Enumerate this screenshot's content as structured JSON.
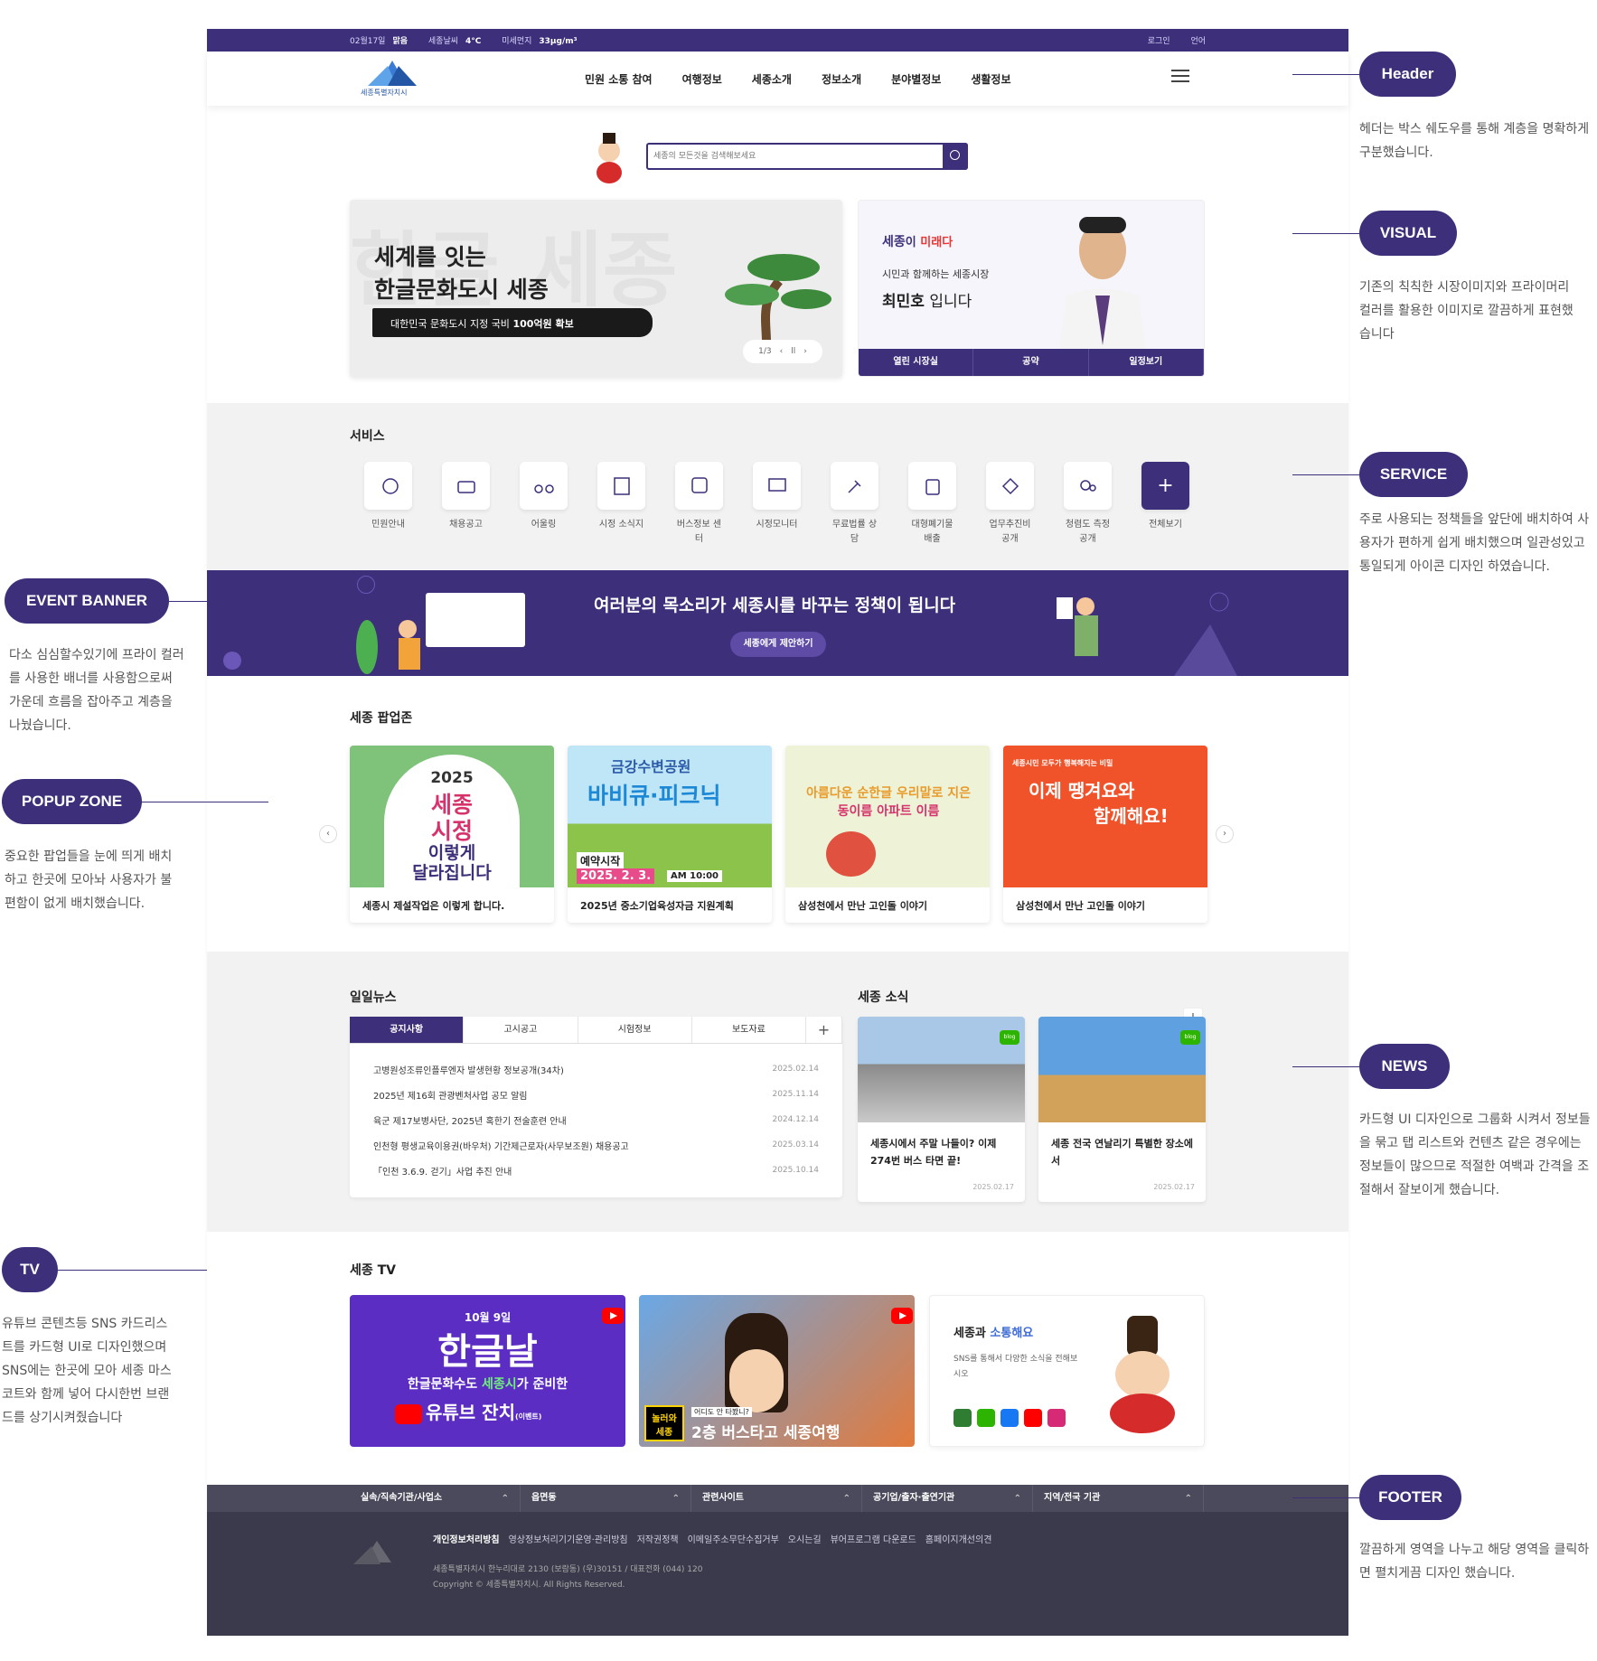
{
  "colors": {
    "primary": "#3d2f7a",
    "accent_red": "#e33333",
    "youtube": "#ff0000",
    "blog": "#2db400"
  },
  "topbar": {
    "date": "02월17일",
    "weather": "맑음",
    "temp_label": "세종날씨",
    "temp": "4°C",
    "dust_label": "미세먼지",
    "dust": "33μg/m³",
    "login": "로그인",
    "lang": "언어"
  },
  "logo": {
    "text": "세종특별자치시"
  },
  "nav": [
    "민원 소통 참여",
    "여행정보",
    "세종소개",
    "정보소개",
    "분야별정보",
    "생활정보"
  ],
  "search": {
    "placeholder": "세종의 모든것을 검색해보세요"
  },
  "hero": {
    "line1": "세계를 잇는",
    "line2": "한글문화도시 세종",
    "sub": "대한민국 문화도시 지정 국비 ",
    "sub_bold": "100억원 확보",
    "page": "1/3",
    "bgtext": "한글 세종"
  },
  "mayor": {
    "slogan_a": "세종",
    "slogan_b": "이 ",
    "slogan_c": "미래",
    "slogan_d": "다",
    "line1": "시민과 함께하는 세종시장",
    "name": "최민호",
    "suffix": " 입니다",
    "tabs": [
      "열린 시장실",
      "공약",
      "일정보기"
    ]
  },
  "service": {
    "title": "서비스",
    "items": [
      {
        "label": "민원안내",
        "icon": "speech-icon"
      },
      {
        "label": "채용공고",
        "icon": "briefcase-icon"
      },
      {
        "label": "어울링",
        "icon": "bicycle-icon"
      },
      {
        "label": "시정 소식지",
        "icon": "newspaper-icon"
      },
      {
        "label": "버스정보 센터",
        "icon": "bus-icon"
      },
      {
        "label": "시정모니터",
        "icon": "monitor-icon"
      },
      {
        "label": "무료법률 상담",
        "icon": "gavel-icon"
      },
      {
        "label": "대형폐기물 배출",
        "icon": "recycle-icon"
      },
      {
        "label": "업무추진비 공개",
        "icon": "money-icon"
      },
      {
        "label": "청렴도 측정 공개",
        "icon": "eye-icon"
      },
      {
        "label": "전체보기",
        "icon": "plus-icon"
      }
    ]
  },
  "event": {
    "title": "여러분의 목소리가 세종시를 바꾸는 정책이 됩니다",
    "button": "세종에게 제안하기"
  },
  "popup": {
    "title": "세종 팝업존",
    "cards": [
      {
        "caption": "세종시 제설작업은 이렇게 합니다.",
        "art1": "2025",
        "art2": "세종",
        "art3": "시정",
        "art4": "이렇게",
        "art5": "달라집니다"
      },
      {
        "caption": "2025년 중소기업육성자금 지원계획",
        "art1": "금강수변공원",
        "art2": "바비큐·피크닉",
        "art3": "예약시작",
        "art4": "2025. 2. 3.",
        "art5": "AM 10:00"
      },
      {
        "caption": "삼성천에서 만난 고인돌 이야기",
        "art1": "아름다운 순한글 우리말로 지은",
        "art2": "동이름 아파트 이름"
      },
      {
        "caption": "삼성천에서 만난 고인돌 이야기",
        "art1": "세종시민 모두가 행복해지는 비밀",
        "art2": "이제 땡겨요와",
        "art3": "함께해요!"
      }
    ]
  },
  "news": {
    "title": "일일뉴스",
    "tabs": [
      "공지사항",
      "고시공고",
      "시험정보",
      "보도자료"
    ],
    "rows": [
      {
        "title": "고병원성조류인플루엔자 발생현황 정보공개(34차)",
        "date": "2025.02.14"
      },
      {
        "title": "2025년 제16회 관광벤처사업 공모 알림",
        "date": "2025.11.14"
      },
      {
        "title": "육군 제17보병사단, 2025년 혹한기 전술훈련 안내",
        "date": "2024.12.14"
      },
      {
        "title": "인천형 평생교육이용권(바우처) 기간제근로자(사무보조원) 채용공고",
        "date": "2025.03.14"
      },
      {
        "title": "「인천 3.6.9. 걷기」사업 추진 안내",
        "date": "2025.10.14"
      }
    ]
  },
  "sejong_news": {
    "title": "세종 소식",
    "cards": [
      {
        "title": "세종시에서 주말 나들이? 이제 274번 버스 타면 끝!",
        "date": "2025.02.17",
        "badge": "blog"
      },
      {
        "title": "세종 전국 연날리기 특별한 장소에서",
        "date": "2025.02.17",
        "badge": "blog"
      }
    ]
  },
  "tv": {
    "title": "세종 TV",
    "card1": {
      "l1": "10월 9일",
      "l2": "한글날",
      "l3a": "한글문화수도 ",
      "l3b": "세종시",
      "l3c": "가 준비한",
      "l4": "유튜브 잔치",
      "l5": "(이벤트)"
    },
    "card2": {
      "tag": "어디도 안 타봤니?",
      "l1": "2층 버스타고 세종여행",
      "l0": "놀러와 세종"
    },
    "sns": {
      "title_a": "세종과 ",
      "title_b": "소통해요",
      "sub": "SNS를 통해서 다양한 소식을 전해보시오"
    }
  },
  "footer": {
    "groups": [
      "실속/직속기관/사업소",
      "읍면동",
      "관련사이트",
      "공기업/출자·출연기관",
      "지역/전국 기관"
    ],
    "links": [
      "개인정보처리방침",
      "영상정보처리기기운영·관리방침",
      "저작권정책",
      "이메일주소무단수집거부",
      "오시는길",
      "뷰어프로그램 다운로드",
      "홈페이지개선의견"
    ],
    "address": "세종특별자치시 한누리대로 2130 (보람동) (우)30151 / 대표전화 (044) 120",
    "copyright": "Copyright © 세종특별자치시. All Rights Reserved."
  },
  "annotations": [
    {
      "label": "Header",
      "note": "헤더는 박스 쉐도우를 통해 계층을 명확하게 구분했습니다."
    },
    {
      "label": "VISUAL",
      "note": "기존의 칙칙한 시장이미지와 프라이머리 컬러를 활용한 이미지로 깔끔하게 표현했습니다"
    },
    {
      "label": "SERVICE",
      "note": "주로 사용되는 정책들을 앞단에 배치하여 사용자가 편하게 쉽게 배치했으며 일관성있고 통일되게 아이콘 디자인 하였습니다."
    },
    {
      "label": "EVENT BANNER",
      "note": "다소 심심할수있기에 프라이 컬러를 사용한 배너를 사용함으로써 가운데 흐름을 잡아주고 계층을 나눴습니다."
    },
    {
      "label": "POPUP ZONE",
      "note": "중요한 팝업들을 눈에 띄게 배치하고 한곳에 모아놔 사용자가 불편함이 없게 배치했습니다."
    },
    {
      "label": "NEWS",
      "note": "카드형 UI 디자인으로 그룹화 시켜서 정보들을 묶고 탭 리스트와 컨텐츠 같은 경우에는 정보들이 많으므로 적절한 여백과 간격을 조절해서 잘보이게 했습니다."
    },
    {
      "label": "TV",
      "note": "유튜브 콘텐츠등 SNS 카드리스트를 카드형 UI로 디자인했으며 SNS에는 한곳에 모아 세종 마스코트와 함께 넣어 다시한번 브랜드를 상기시켜줬습니다"
    },
    {
      "label": "FOOTER",
      "note": "깔끔하게 영역을 나누고 해당 영역을 클릭하면 펼치게끔 디자인 했습니다."
    }
  ]
}
